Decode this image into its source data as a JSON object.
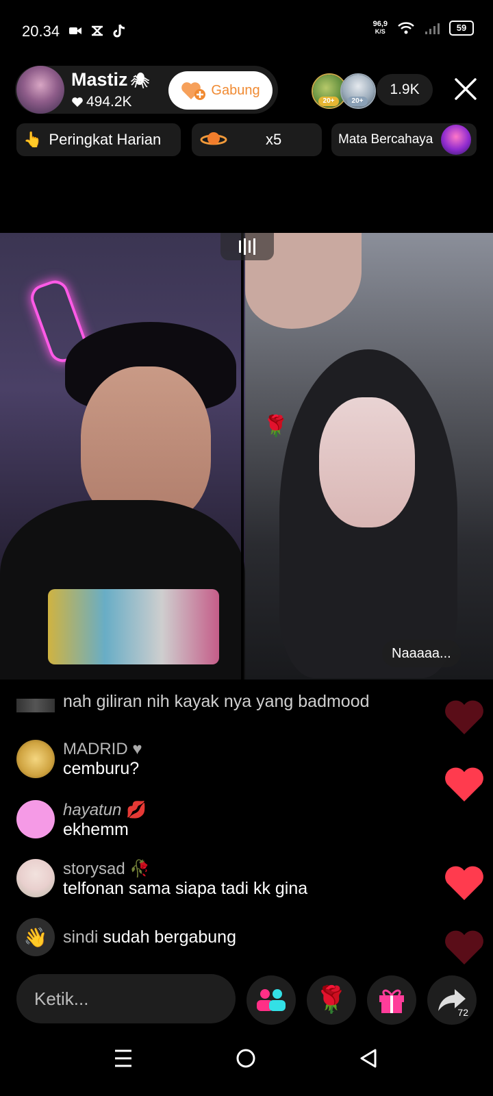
{
  "status_bar": {
    "time": "20.34",
    "speed_value": "96,9",
    "speed_unit": "K/S",
    "battery": "59"
  },
  "host": {
    "name": "Mastiz",
    "name_emoji": "🕷",
    "likes": "494.2K",
    "join_label": "Gabung"
  },
  "viewers": {
    "badge_1": "20+",
    "badge_2": "20+",
    "count": "1.9K"
  },
  "chips": {
    "ranking": "Peringkat Harian",
    "multiplier": "x5",
    "effect": "Mata Bercahaya"
  },
  "video": {
    "cohost_tag": "Naaaaa..."
  },
  "comments": [
    {
      "name": "",
      "text": "nah giliran nih kayak nya yang badmood"
    },
    {
      "name": "MADRID",
      "text": "cemburu?"
    },
    {
      "name": "hayatun",
      "text": "ekhemm"
    },
    {
      "name": "storysad",
      "text": "telfonan sama siapa tadi kk gina"
    },
    {
      "name": "sindi",
      "text": "sudah bergabung"
    }
  ],
  "input": {
    "placeholder": "Ketik..."
  },
  "share": {
    "count": "72"
  },
  "colors": {
    "accent_orange": "#f08a32",
    "heart_red": "#ff3b4e",
    "heart_dim": "#5a0d18",
    "panel": "#1c1c1c"
  },
  "icons": [
    "video-icon",
    "tiktok-icon",
    "wifi-icon",
    "signal-icon",
    "battery-icon",
    "heart-icon",
    "close-icon",
    "fire-icon",
    "planet-icon",
    "guest-icon",
    "rose-icon",
    "gift-icon",
    "share-icon",
    "menu-icon",
    "home-icon",
    "back-icon"
  ]
}
